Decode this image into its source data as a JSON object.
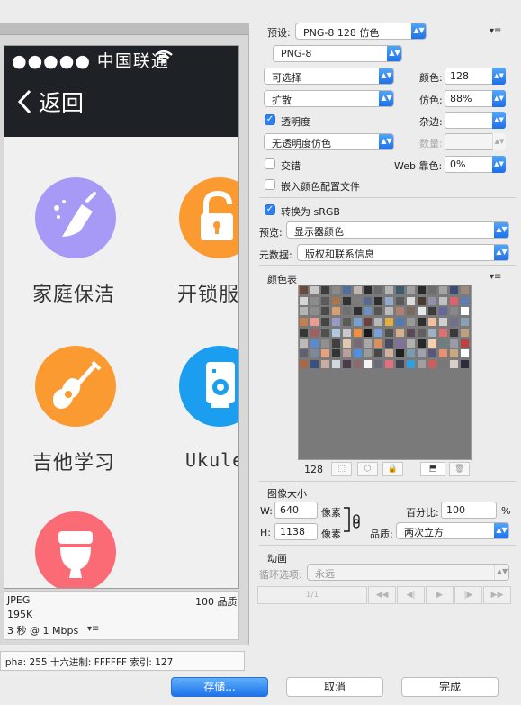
{
  "preview": {
    "carrier": "●●●●● 中国联通",
    "back_label": "返回",
    "services": [
      {
        "label": "家庭保洁",
        "icon": "broom-icon",
        "color": "#a79af7"
      },
      {
        "label": "开锁服",
        "icon": "unlock-icon",
        "color": "#fb9a30"
      },
      {
        "label": "吉他学习",
        "icon": "guitar-icon",
        "color": "#fb9a30"
      },
      {
        "label": "Ukule",
        "icon": "speaker-icon",
        "color": "#1b9df0"
      },
      {
        "label": "",
        "icon": "toilet-icon",
        "color": "#fb6b76"
      }
    ],
    "info": {
      "format": "JPEG",
      "quality": "100 品质",
      "size": "195K",
      "time": "3 秒 @ 1 Mbps"
    },
    "status_line": "lpha: 255     十六进制: FFFFFF     索引: 127"
  },
  "settings": {
    "preset_label": "预设:",
    "preset_value": "PNG-8 128 仿色",
    "format_value": "PNG-8",
    "reduction_value": "可选择",
    "colors_label": "颜色:",
    "colors_value": "128",
    "dither_algo_value": "扩散",
    "dither_label": "仿色:",
    "dither_value": "88%",
    "transparency_label": "透明度",
    "transparency_checked": true,
    "matte_label": "杂边:",
    "trans_dither_value": "无透明度仿色",
    "amount_label": "数量:",
    "interlaced_label": "交错",
    "interlaced_checked": false,
    "websnap_label": "Web 靠色:",
    "websnap_value": "0%",
    "embed_profile_label": "嵌入颜色配置文件",
    "embed_profile_checked": false,
    "convert_srgb_label": "转换为 sRGB",
    "convert_srgb_checked": true,
    "preview_label": "预览:",
    "preview_value": "显示器颜色",
    "metadata_label": "元数据:",
    "metadata_value": "版权和联系信息"
  },
  "color_table": {
    "title": "颜色表",
    "count": "128",
    "colors": [
      "#6b4a3c",
      "#c9c9c9",
      "#3e3e3e",
      "#8a8a8a",
      "#4d6fa0",
      "#c0b8b0",
      "#2c2c2c",
      "#6a6a6a",
      "#b5b5b5",
      "#3d5a6e",
      "#a0a0a0",
      "#2a2a2a",
      "#6d6d6d",
      "#a4a4a4",
      "#3b4d73",
      "#9c8a7a",
      "#d6d6d6",
      "#8c8c8c",
      "#5b5b5b",
      "#a8764e",
      "#323232",
      "#7c7c7c",
      "#566b8e",
      "#2e2e2e",
      "#94aacb",
      "#5a5a5a",
      "#dcdcdc",
      "#4a3a30",
      "#9090a8",
      "#c0c0c0",
      "#e06070",
      "#5c7fb8",
      "#b4b4b4",
      "#8d8d8d",
      "#4a4a4a",
      "#d8a070",
      "#707070",
      "#303030",
      "#6e8fc2",
      "#555555",
      "#bcbcbc",
      "#b08070",
      "#7a6a5a",
      "#e8e8e8",
      "#3c3c3c",
      "#6464a0",
      "#888888",
      "#ffffff",
      "#c08050",
      "#ef9a90",
      "#444444",
      "#9a9ac8",
      "#5a5a5a",
      "#78a0d0",
      "#6a4040",
      "#b8b8b8",
      "#e2b040",
      "#4e7db5",
      "#999999",
      "#2f2f2f",
      "#f0c0a0",
      "#d0d0d0",
      "#707090",
      "#8aa0b8",
      "#383838",
      "#a06060",
      "#505050",
      "#b0c8e0",
      "#c8c8c8",
      "#f09040",
      "#1a1a1a",
      "#7aa0d8",
      "#505050",
      "#d8b090",
      "#5a4a5a",
      "#606060",
      "#a0b0c0",
      "#e07070",
      "#3a3a3a",
      "#c0a080",
      "#bbbbbb",
      "#5a8ad0",
      "#909090",
      "#404040",
      "#e0c8b0",
      "#786878",
      "#a8a8a8",
      "#d89060",
      "#4a4a60",
      "#8070a0",
      "#b0b0b0",
      "#282828",
      "#f4d0b0",
      "#6a8080",
      "#9a9aaa",
      "#c04040",
      "#606070",
      "#7a8a9a",
      "#e8a080",
      "#343434",
      "#b8a0a0",
      "#5090e0",
      "#9a9a9a",
      "#484848",
      "#d0b0a0",
      "#202020",
      "#7a9ab0",
      "#a0a0b0",
      "#585878",
      "#e89070",
      "#c8a880",
      "#ffffff",
      "#a86848",
      "#3a5080",
      "#c8b0a0",
      "#d0d8e0",
      "#4a3a4a",
      "#8a6a6a",
      "#f4f4f4",
      "#6a6a7a",
      "#e07080",
      "#404050",
      "#30a0e0",
      "#a0a0a0",
      "#c86060",
      "#787878",
      "#d8d0c8",
      "#2c2c3c"
    ]
  },
  "image_size": {
    "title": "图像大小",
    "w_label": "W:",
    "w_value": "640",
    "h_label": "H:",
    "h_value": "1138",
    "unit": "像素",
    "percent_label": "百分比:",
    "percent_value": "100",
    "percent_unit": "%",
    "quality_label": "品质:",
    "quality_value": "两次立方"
  },
  "animation": {
    "title": "动画",
    "loop_label": "循环选项:",
    "loop_value": "永远",
    "frame_counter": "1/1"
  },
  "buttons": {
    "save": "存储...",
    "cancel": "取消",
    "done": "完成"
  }
}
